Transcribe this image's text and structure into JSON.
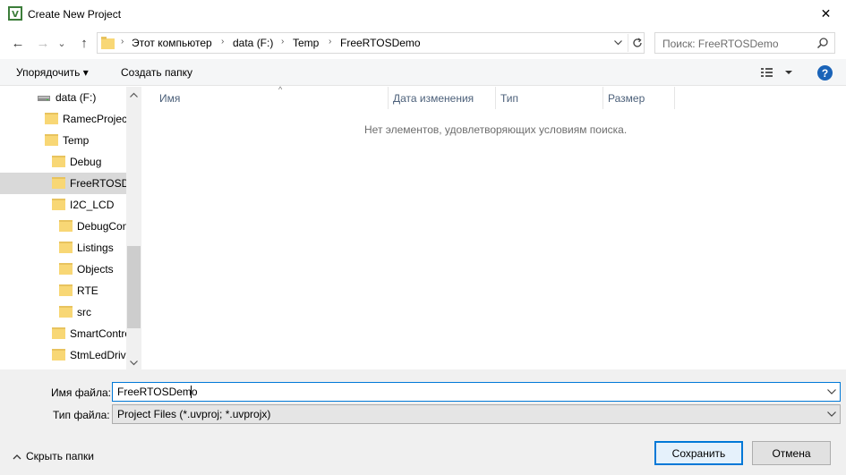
{
  "window": {
    "title": "Create New Project",
    "close_glyph": "✕"
  },
  "navigation": {
    "back_glyph": "←",
    "forward_glyph": "→",
    "recent_glyph": "⌄",
    "up_glyph": "↑"
  },
  "address_bar": {
    "crumbs": [
      "Этот компьютер",
      "data (F:)",
      "Temp",
      "FreeRTOSDemo"
    ],
    "separator": "›"
  },
  "search": {
    "placeholder": "Поиск: FreeRTOSDemo"
  },
  "toolbar": {
    "organize_label": "Упорядочить ▾",
    "new_folder_label": "Создать папку",
    "help_label": "?"
  },
  "tree": {
    "items": [
      {
        "label": "data (F:)",
        "kind": "drive"
      },
      {
        "label": "RamecProject",
        "kind": "folder"
      },
      {
        "label": "Temp",
        "kind": "folder"
      },
      {
        "label": "Debug",
        "kind": "folder"
      },
      {
        "label": "FreeRTOSDemo",
        "kind": "folder",
        "selected": true
      },
      {
        "label": "I2C_LCD",
        "kind": "folder"
      },
      {
        "label": "DebugConfig",
        "kind": "folder"
      },
      {
        "label": "Listings",
        "kind": "folder"
      },
      {
        "label": "Objects",
        "kind": "folder"
      },
      {
        "label": "RTE",
        "kind": "folder"
      },
      {
        "label": "src",
        "kind": "folder"
      },
      {
        "label": "SmartController",
        "kind": "folder"
      },
      {
        "label": "StmLedDriver",
        "kind": "folder"
      }
    ]
  },
  "file_list": {
    "columns": [
      "Имя",
      "Дата изменения",
      "Тип",
      "Размер"
    ],
    "empty_message": "Нет элементов, удовлетворяющих условиям поиска.",
    "sort_glyph": "^"
  },
  "form": {
    "filename_label": "Имя файла:",
    "filename_value": "FreeRTOSDemo",
    "filetype_label": "Тип файла:",
    "filetype_value": "Project Files (*.uvproj; *.uvprojx)",
    "hide_folders_label": "Скрыть папки",
    "save_label": "Сохранить",
    "cancel_label": "Отмена"
  },
  "colors": {
    "accent": "#0078d7",
    "selection": "#d9d9d9",
    "folder": "#f8d775",
    "help": "#1a63b8"
  }
}
